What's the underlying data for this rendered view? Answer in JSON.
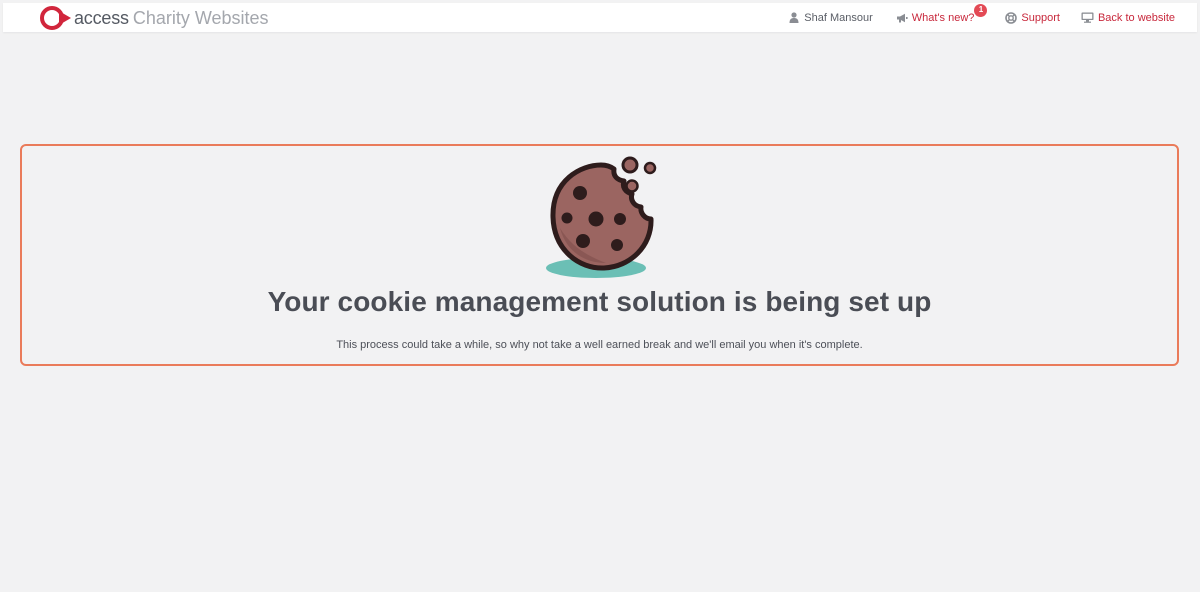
{
  "header": {
    "brand_name": "access",
    "brand_sub": "Charity Websites",
    "logo_icon": "access-logo-icon",
    "nav": {
      "user": {
        "label": "Shaf Mansour",
        "icon": "user-icon"
      },
      "whats_new": {
        "label": "What's new?",
        "icon": "megaphone-icon",
        "badge": "1"
      },
      "support": {
        "label": "Support",
        "icon": "lifebuoy-icon"
      },
      "back": {
        "label": "Back to website",
        "icon": "monitor-icon"
      }
    }
  },
  "main": {
    "illustration": "cookie-icon",
    "title": "Your cookie management solution is being set up",
    "message": "This process could take a while, so why not take a well earned break and we'll email you when it's complete."
  },
  "colors": {
    "accent": "#c8283c",
    "card_border": "#ea7b5a",
    "background": "#f2f2f3",
    "cookie": "#9b6561",
    "cookie_outline": "#2e1c1c",
    "shadow": "#6bbfb5"
  }
}
